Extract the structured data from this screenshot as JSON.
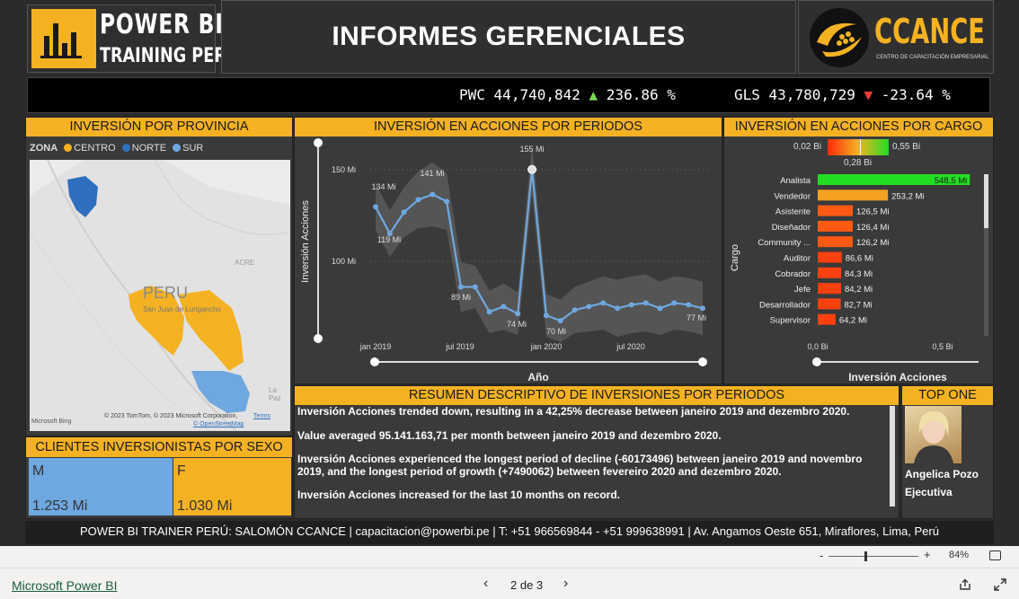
{
  "header": {
    "logo_line1": "POWER BI",
    "logo_line2": "TRAINING PERÚ",
    "title": "INFORMES GERENCIALES",
    "brand": "CCANCE",
    "brand_sub": "CENTRO DE CAPACITACIÓN EMPRESARIAL"
  },
  "ticker": {
    "items": [
      {
        "symbol": "PWC",
        "value": "44,740,842",
        "arrow": "▲",
        "change": "236.86 %",
        "arrow_color": "#7ed957"
      },
      {
        "symbol": "GLS",
        "value": "43,780,729",
        "arrow": "▼",
        "change": "-23.64 %",
        "arrow_color": "#ff3b3b"
      }
    ]
  },
  "map_panel": {
    "title": "INVERSIÓN POR PROVINCIA",
    "legend_title": "ZONA",
    "legend": [
      {
        "label": "CENTRO",
        "color": "#f4b223"
      },
      {
        "label": "NORTE",
        "color": "#2f6fbf"
      },
      {
        "label": "SUR",
        "color": "#6fa8e0"
      }
    ],
    "country_label": "PERU",
    "city_label": "San Juan de Lurigancho",
    "acre_label": "ACRE",
    "lapaz_label": "La Paz",
    "bing": "Microsoft Bing",
    "copyright": "© 2023 TomTom, © 2023 Microsoft Corporation,",
    "terms": "Terms",
    "osm": "© OpenStreetMap"
  },
  "sex_panel": {
    "title": "CLIENTES INVERSIONISTAS POR SEXO",
    "tiles": [
      {
        "label": "M",
        "value": "1.253 Mi",
        "color": "#6fa8e0"
      },
      {
        "label": "F",
        "value": "1.030 Mi",
        "color": "#f4b223"
      }
    ]
  },
  "line_panel": {
    "title": "INVERSIÓN EN ACCIONES POR PERIODOS",
    "y_axis_title": "Inversión Acciones",
    "x_axis_title": "Año",
    "y_ticks": [
      "150 Mi",
      "100 Mi"
    ],
    "x_ticks": [
      "jan 2019",
      "jul 2019",
      "jan 2020",
      "jul 2020"
    ],
    "data_labels": [
      "134 Mi",
      "119 Mi",
      "141 Mi",
      "89 Mi",
      "74 Mi",
      "155 Mi",
      "70 Mi",
      "77 Mi"
    ]
  },
  "chart_data": [
    {
      "type": "line",
      "title": "INVERSIÓN EN ACCIONES POR PERIODOS",
      "xlabel": "Año",
      "ylabel": "Inversión Acciones",
      "unit": "Mi",
      "x": [
        "2019-01",
        "2019-02",
        "2019-03",
        "2019-04",
        "2019-05",
        "2019-06",
        "2019-07",
        "2019-08",
        "2019-09",
        "2019-10",
        "2019-11",
        "2019-12",
        "2020-01",
        "2020-02",
        "2020-03",
        "2020-04",
        "2020-05",
        "2020-06",
        "2020-07",
        "2020-08",
        "2020-09",
        "2020-10",
        "2020-11",
        "2020-12"
      ],
      "series": [
        {
          "name": "",
          "values": [
            134,
            119,
            131,
            138,
            141,
            137,
            89,
            89,
            75,
            78,
            74,
            155,
            73,
            70,
            76,
            78,
            80,
            77,
            79,
            80,
            77,
            80,
            79,
            77
          ]
        }
      ],
      "band_half_width": [
        13,
        13,
        14,
        16,
        18,
        16,
        14,
        12,
        12,
        13,
        12,
        14,
        12,
        12,
        13,
        14,
        15,
        16,
        16,
        16,
        15,
        15,
        15,
        15
      ],
      "ylim": [
        60,
        170
      ],
      "y_ticks": [
        100,
        150
      ],
      "grid": true
    },
    {
      "type": "bar",
      "orientation": "horizontal",
      "title": "INVERSIÓN EN ACCIONES POR CARGO",
      "xlabel": "Inversión Acciones",
      "ylabel": "Cargo",
      "unit": "Mi",
      "categories": [
        "Analista",
        "Vendedor",
        "Asistente",
        "Diseñador",
        "Community ...",
        "Auditor",
        "Cobrador",
        "Jefe",
        "Desarrollador",
        "Supervisor"
      ],
      "values": [
        548.5,
        253.2,
        126.5,
        126.4,
        126.2,
        86.6,
        84.3,
        84.2,
        82.7,
        64.2
      ],
      "value_labels": [
        "548,5 Mi",
        "253,2 Mi",
        "126,5 Mi",
        "126,4 Mi",
        "126,2 Mi",
        "86,6 Mi",
        "84,3 Mi",
        "84,2 Mi",
        "82,7 Mi",
        "64,2 Mi"
      ],
      "colors": [
        "#22dd22",
        "#f4a020",
        "#ff5a14",
        "#ff5a14",
        "#ff5a14",
        "#ff4010",
        "#ff4010",
        "#ff4010",
        "#ff4010",
        "#ff4010"
      ],
      "xlim": [
        0,
        580
      ],
      "x_ticks": [
        "0,0 Bi",
        "0,5 Bi"
      ],
      "gradient_legend": {
        "min": "0,02 Bi",
        "mid": "0,28 Bi",
        "max": "0,55 Bi"
      }
    }
  ],
  "bar_panel": {
    "title": "INVERSIÓN EN ACCIONES POR CARGO",
    "y_axis_title": "Cargo",
    "x_axis_title": "Inversión Acciones",
    "x_ticks": [
      "0,0 Bi",
      "0,5 Bi"
    ],
    "grad_min": "0,02 Bi",
    "grad_mid": "0,28 Bi",
    "grad_max": "0,55 Bi"
  },
  "summary": {
    "title": "RESUMEN DESCRIPTIVO DE INVERSIONES POR PERIODOS",
    "paragraphs": [
      "Inversión Acciones trended down, resulting in a 42,25% decrease between janeiro 2019 and dezembro 2020.",
      "Value averaged 95.141.163,71 per month between janeiro 2019 and dezembro 2020.",
      "Inversión Acciones experienced the longest period of decline (-60173496) between janeiro 2019 and novembro 2019, and the longest period of growth (+7490062) between fevereiro 2020 and dezembro 2020.",
      "Inversión Acciones increased for the last 10 months on record."
    ]
  },
  "top_one": {
    "title": "TOP ONE",
    "name": "Angelica Pozo",
    "role": "Ejecutiva"
  },
  "footer": {
    "text": "POWER BI TRAINER PERÚ: SALOMÓN CCANCE | capacitacion@powerbi.pe | T: +51 966569844 - +51 999638991 | Av. Angamos Oeste 651, Miraflores, Lima, Perú"
  },
  "zoom": {
    "minus": "-",
    "plus": "+",
    "level": "84%"
  },
  "bottombar": {
    "app_link": "Microsoft Power BI",
    "page_indicator": "2 de 3"
  }
}
